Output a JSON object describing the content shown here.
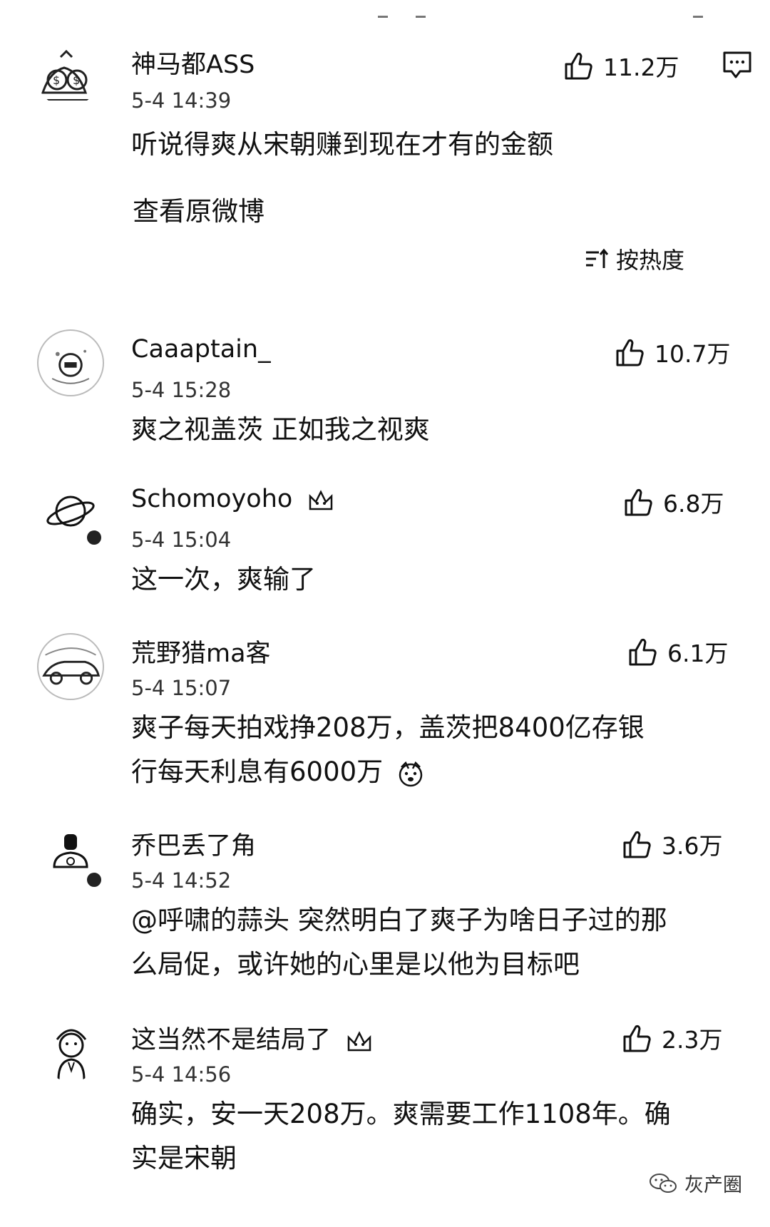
{
  "post": {
    "author": "神马都ASS",
    "time": "5-4 14:39",
    "text": "听说得爽从宋朝赚到现在才有的金额",
    "view_original": "查看原微博",
    "likes": "11.2万"
  },
  "sort_label": "按热度",
  "comments": [
    {
      "name": "Caaaptain_",
      "time": "5-4 15:28",
      "text": "爽之视盖茨 正如我之视爽",
      "likes": "10.7万"
    },
    {
      "name": "Schomoyoho",
      "time": "5-4 15:04",
      "text": "这一次，爽输了",
      "likes": "6.8万"
    },
    {
      "name": "荒野猎ma客",
      "time": "5-4 15:07",
      "text_line1": "爽子每天拍戏挣208万，盖茨把8400亿存银",
      "text_line2": "行每天利息有6000万",
      "likes": "6.1万"
    },
    {
      "name": "乔巴丢了角",
      "time": "5-4 14:52",
      "text_line1": "@呼啸的蒜头 突然明白了爽子为啥日子过的那",
      "text_line2": "么局促，或许她的心里是以他为目标吧",
      "likes": "3.6万"
    },
    {
      "name": "这当然不是结局了",
      "time": "5-4 14:56",
      "text_line1": "确实，安一天208万。爽需要工作1108年。确",
      "text_line2": "实是宋朝",
      "likes": "2.3万"
    }
  ],
  "watermark": "灰产圈",
  "icons": [
    "thumbs-up-icon",
    "comment-icon",
    "sort-icon",
    "crown-badge-icon",
    "dog-face-emoji",
    "wechat-icon"
  ]
}
